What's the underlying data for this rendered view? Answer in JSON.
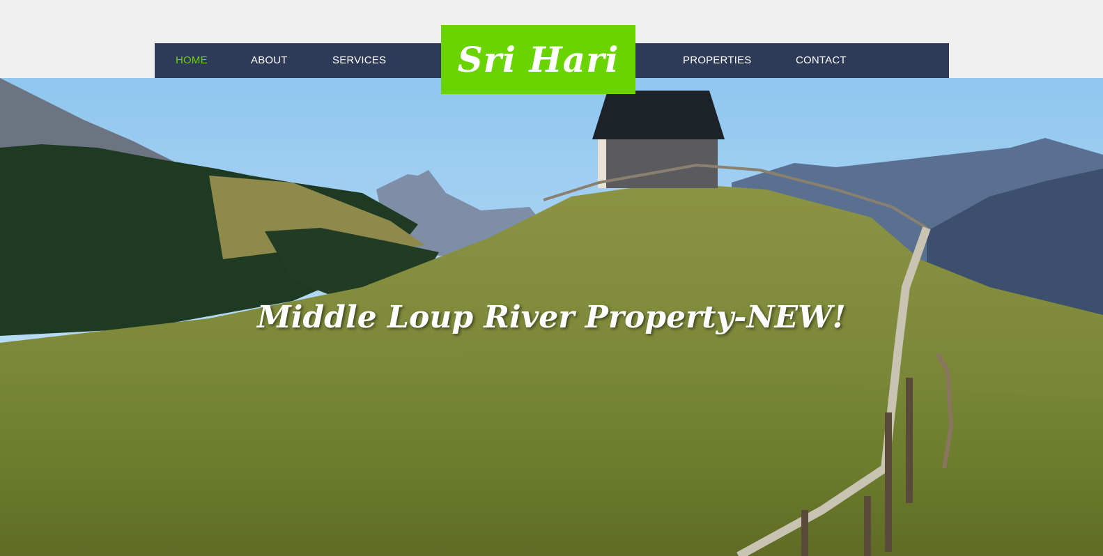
{
  "brand": {
    "name": "Sri Hari"
  },
  "nav": {
    "items": [
      {
        "label": "HOME",
        "active": true
      },
      {
        "label": "ABOUT",
        "active": false
      },
      {
        "label": "SERVICES",
        "active": false
      },
      {
        "label": "PROPERTIES",
        "active": false
      },
      {
        "label": "CONTACT",
        "active": false
      }
    ]
  },
  "hero": {
    "title": "Middle Loup River Property-NEW!"
  },
  "colors": {
    "nav_bg": "#2d3a58",
    "accent": "#6ad400",
    "page_bg": "#efefef"
  }
}
